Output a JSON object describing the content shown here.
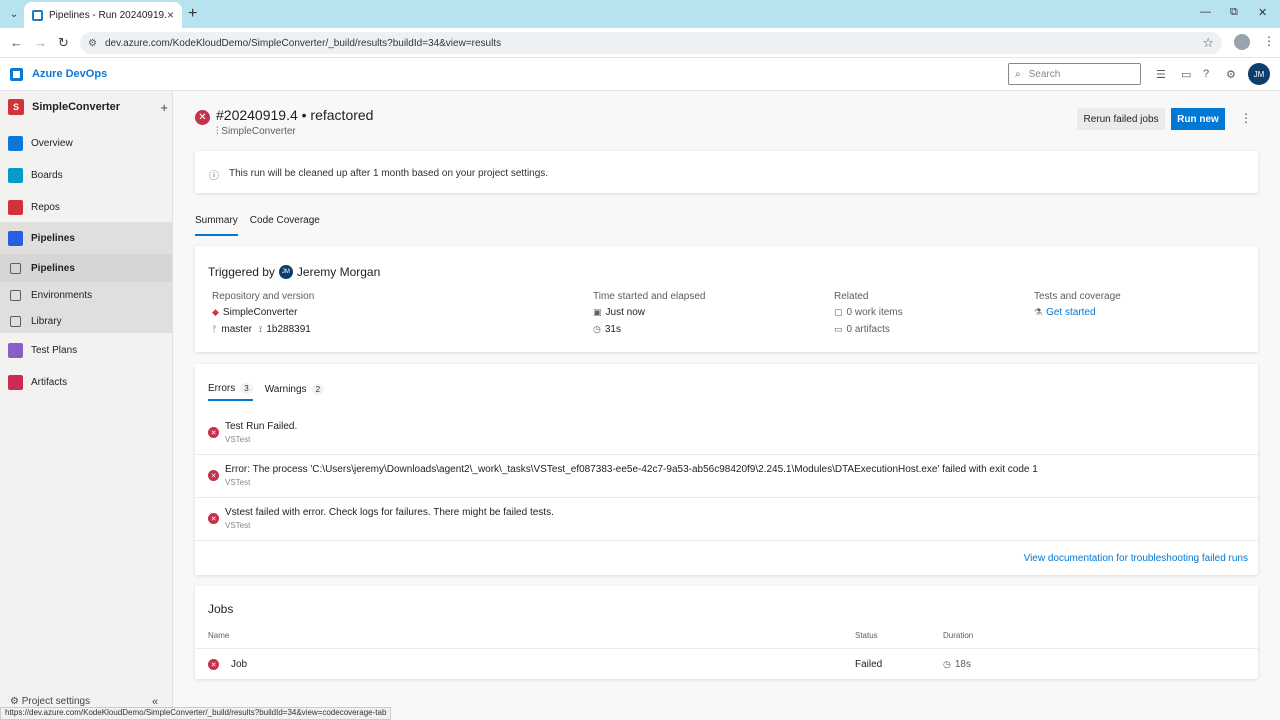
{
  "browser": {
    "tab_title": "Pipelines - Run 20240919.4",
    "url": "dev.azure.com/KodeKloudDemo/SimpleConverter/_build/results?buildId=34&view=results",
    "status_url": "https://dev.azure.com/KodeKloudDemo/SimpleConverter/_build/results?buildId=34&view=codecoverage-tab"
  },
  "header": {
    "product": "Azure DevOps",
    "search_placeholder": "Search",
    "user_initials": "JM"
  },
  "sidebar": {
    "project_initial": "S",
    "project_name": "SimpleConverter",
    "items": [
      {
        "label": "Overview",
        "color": "#0a78d4"
      },
      {
        "label": "Boards",
        "color": "#009ccc"
      },
      {
        "label": "Repos",
        "color": "#d13438"
      },
      {
        "label": "Pipelines",
        "color": "#2560e0"
      },
      {
        "label": "Pipelines"
      },
      {
        "label": "Environments"
      },
      {
        "label": "Library"
      },
      {
        "label": "Test Plans",
        "color": "#8661c5"
      },
      {
        "label": "Artifacts",
        "color": "#cc2b53"
      }
    ],
    "settings": "Project settings"
  },
  "run": {
    "title": "#20240919.4 • refactored",
    "pipeline": "SimpleConverter",
    "rerun_label": "Rerun failed jobs",
    "runnew_label": "Run new",
    "info": "This run will be cleaned up after 1 month based on your project settings."
  },
  "tabs": [
    "Summary",
    "Code Coverage"
  ],
  "summary": {
    "triggered_by_label": "Triggered by",
    "triggered_initials": "JM",
    "triggered_name": "Jeremy Morgan",
    "repo_header": "Repository and version",
    "repo_name": "SimpleConverter",
    "branch": "master",
    "commit": "1b288391",
    "time_header": "Time started and elapsed",
    "started": "Just now",
    "elapsed": "31s",
    "related_header": "Related",
    "work_items": "0 work items",
    "artifacts": "0 artifacts",
    "tests_header": "Tests and coverage",
    "get_started": "Get started"
  },
  "issues": {
    "errors_label": "Errors",
    "errors_count": "3",
    "warnings_label": "Warnings",
    "warnings_count": "2",
    "rows": [
      {
        "message": "Test Run Failed.",
        "source": "VSTest"
      },
      {
        "message": "Error: The process 'C:\\Users\\jeremy\\Downloads\\agent2\\_work\\_tasks\\VSTest_ef087383-ee5e-42c7-9a53-ab56c98420f9\\2.245.1\\Modules\\DTAExecutionHost.exe' failed with exit code 1",
        "source": "VSTest"
      },
      {
        "message": "Vstest failed with error. Check logs for failures. There might be failed tests.",
        "source": "VSTest"
      }
    ],
    "doc_link": "View documentation for troubleshooting failed runs"
  },
  "jobs": {
    "title": "Jobs",
    "headers": {
      "name": "Name",
      "status": "Status",
      "duration": "Duration"
    },
    "rows": [
      {
        "name": "Job",
        "status": "Failed",
        "duration": "18s"
      }
    ]
  }
}
